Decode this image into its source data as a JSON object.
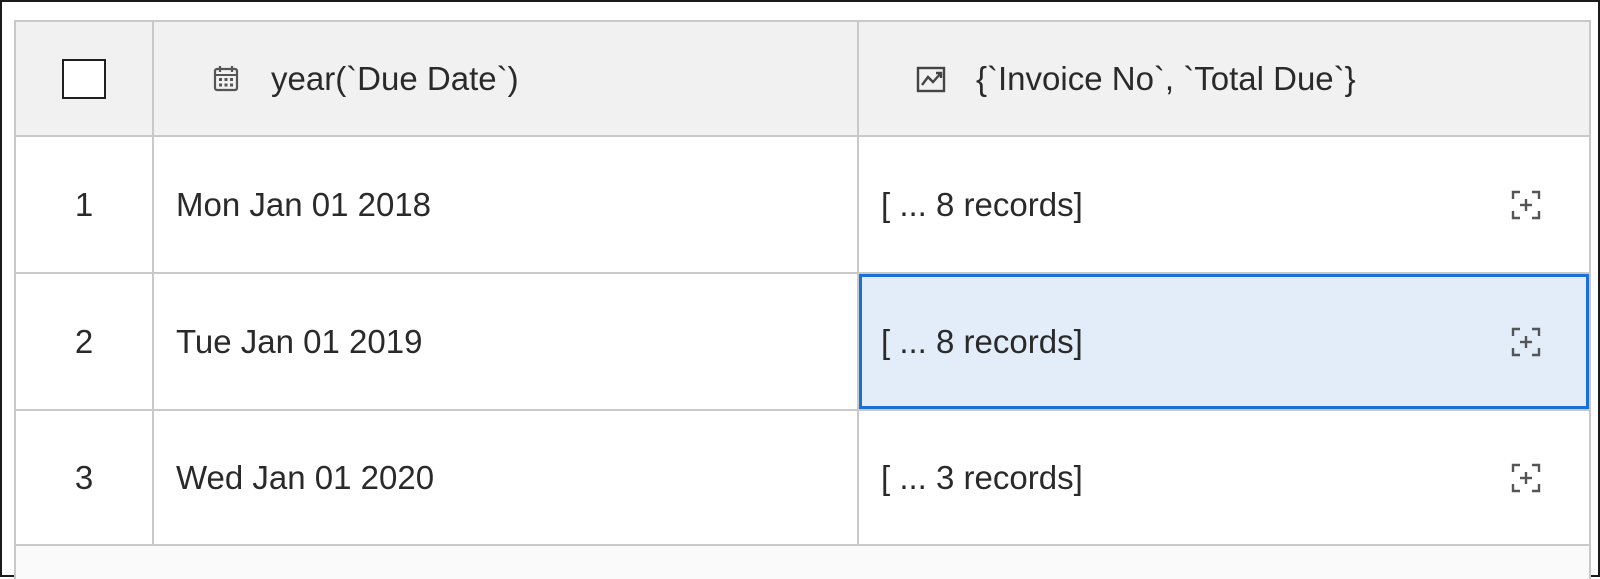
{
  "table": {
    "columns": [
      {
        "label": "",
        "icon": "checkbox"
      },
      {
        "label": "year(`Due Date`)",
        "icon": "calendar-icon"
      },
      {
        "label": "{`Invoice No`, `Total Due`}",
        "icon": "chart-icon"
      }
    ],
    "rows": [
      {
        "index": "1",
        "date": "Mon Jan 01 2018",
        "records": "[ ... 8 records]",
        "selected": false
      },
      {
        "index": "2",
        "date": "Tue Jan 01 2019",
        "records": "[ ... 8 records]",
        "selected": true
      },
      {
        "index": "3",
        "date": "Wed Jan 01 2020",
        "records": "[ ... 3 records]",
        "selected": false
      }
    ]
  },
  "colors": {
    "selection_border": "#1a6fd8",
    "selection_fill": "#e2edf9",
    "header_bg": "#f1f1f1",
    "grid_line": "#c9c9c9"
  }
}
